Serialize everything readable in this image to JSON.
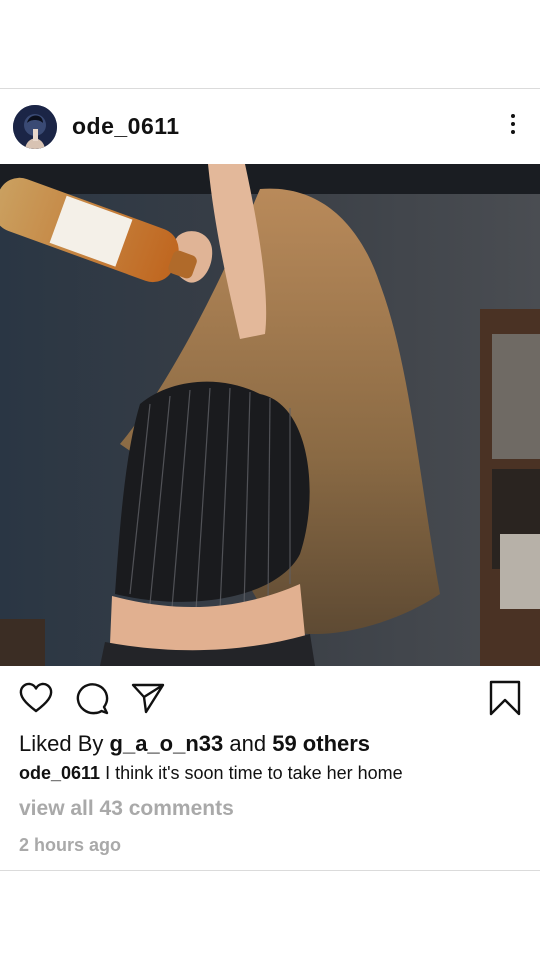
{
  "post": {
    "username": "ode_0611",
    "liked_by_prefix": "Liked By",
    "liked_by_user": "g_a_o_n33",
    "liked_by_and": "and",
    "liked_by_others": "59 others",
    "caption_user": "ode_0611",
    "caption_text": "I think it's soon time to take her home",
    "view_comments": "view all 43 comments",
    "timestamp": "2 hours ago"
  },
  "icons": {
    "more": "more-vertical-icon",
    "like": "heart-icon",
    "comment": "comment-icon",
    "share": "send-icon",
    "save": "bookmark-icon"
  },
  "colors": {
    "text": "#111111",
    "muted": "#a9a9a9",
    "divider": "#dbdbdb",
    "background": "#ffffff"
  }
}
